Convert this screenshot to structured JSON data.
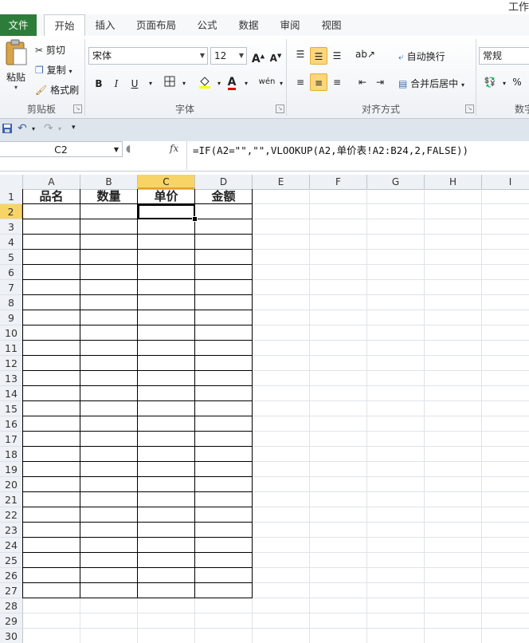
{
  "window": {
    "title_partial": "工作"
  },
  "tabs": [
    "文件",
    "开始",
    "插入",
    "页面布局",
    "公式",
    "数据",
    "审阅",
    "视图"
  ],
  "ribbon": {
    "clipboard": {
      "label": "剪贴板",
      "paste": "粘贴",
      "cut": "剪切",
      "copy": "复制",
      "format_painter": "格式刷"
    },
    "font": {
      "label": "字体",
      "name": "宋体",
      "size": "12",
      "bold": "B",
      "italic": "I",
      "underline": "U",
      "wen": "wén"
    },
    "alignment": {
      "label": "对齐方式",
      "wrap": "自动换行",
      "merge": "合并后居中"
    },
    "number": {
      "format": "常规",
      "label_partial": "数字",
      "percent": "%"
    }
  },
  "formula_bar": {
    "name_box": "C2",
    "fx": "fx",
    "formula": "=IF(A2=\"\",\"\",VLOOKUP(A2,单价表!A2:B24,2,FALSE))"
  },
  "sheet": {
    "columns": [
      "A",
      "B",
      "C",
      "D",
      "E",
      "F",
      "G",
      "H",
      "I"
    ],
    "selected_column": "C",
    "selected_row": 2,
    "rows": [
      "1",
      "2",
      "3",
      "4",
      "5",
      "6",
      "7",
      "8",
      "9",
      "10",
      "11",
      "12",
      "13",
      "14",
      "15",
      "16",
      "17",
      "18",
      "19",
      "20",
      "21",
      "22",
      "23",
      "24",
      "25",
      "26",
      "27",
      "28",
      "29",
      "30"
    ],
    "headers": [
      "品名",
      "数量",
      "单价",
      "金额"
    ],
    "table_last_row": 27
  }
}
